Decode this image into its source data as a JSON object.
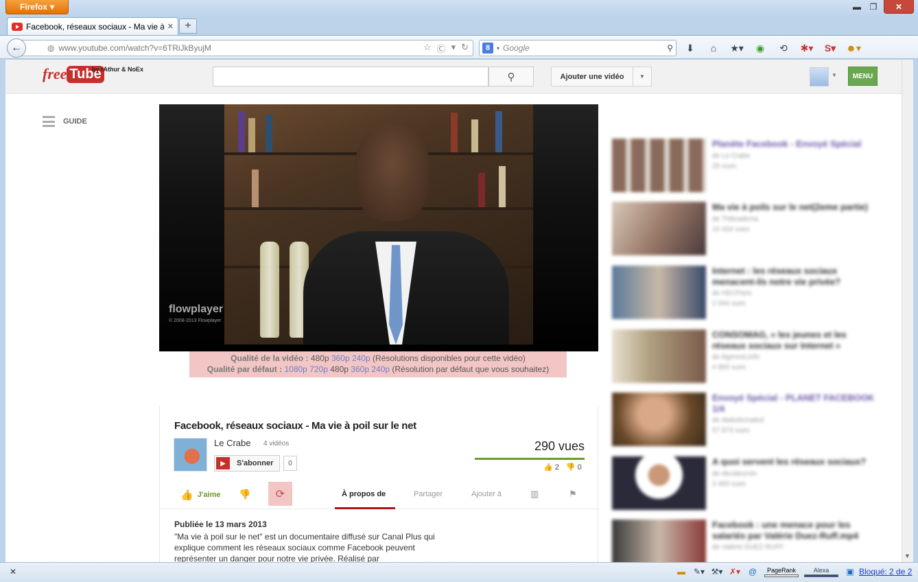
{
  "browser": {
    "app_button": "Firefox",
    "tab_title": "Facebook, réseaux sociaux - Ma vie à poil...",
    "url": "www.youtube.com/watch?v=6TRiJkByujM",
    "search_placeholder": "Google",
    "status_blocked": "Bloqué: 2 de 2",
    "pagerank_label": "PageRank",
    "alexa_label": "Alexa"
  },
  "header": {
    "logo_free": "free",
    "logo_tube": "Tube",
    "logo_by": "by rAthur & NoEx",
    "upload_label": "Ajouter une vidéo",
    "menu_label": "MENU",
    "guide_label": "GUIDE"
  },
  "player": {
    "brand": "flowplayer",
    "copyright": "© 2008-2013 Flowplayer"
  },
  "quality": {
    "line1_label": "Qualité de la vidéo :",
    "line1_options": [
      "480p",
      "360p",
      "240p"
    ],
    "line1_note": "(Résolutions disponibles pour cette vidéo)",
    "line2_label": "Qualité par défaut :",
    "line2_options": [
      "1080p",
      "720p",
      "480p",
      "360p",
      "240p"
    ],
    "line2_note": "(Résolution par défaut que vous souhaitez)"
  },
  "video": {
    "title": "Facebook, réseaux sociaux - Ma vie à poil sur le net",
    "channel": "Le Crabe",
    "video_count": "4 vidéos",
    "subscribe_label": "S'abonner",
    "subscriber_count": "0",
    "views": "290 vues",
    "likes": "2",
    "dislikes": "0",
    "like_label": "J'aime",
    "tabs": {
      "about": "À propos de",
      "share": "Partager",
      "add": "Ajouter à"
    },
    "published": "Publiée le 13 mars 2013",
    "description": "\"Ma vie à poil sur le net\" est un documentaire diffusé sur Canal Plus qui explique comment les réseaux sociaux comme Facebook peuvent représenter un danger pour notre vie privée. Réalisé par"
  },
  "related": [
    {
      "title": "Planète Facebook - Envoyé Spécial",
      "channel": "de Le Crabe",
      "views": "26 vues",
      "color": "#6b55a8"
    },
    {
      "title": "Ma vie à poils sur le net(2eme partie)",
      "channel": "de Thibradema",
      "views": "10 434 vues",
      "color": "#333333"
    },
    {
      "title": "Internet : les réseaux sociaux menacent-ils notre vie privée?",
      "channel": "de HECParis",
      "views": "2 044 vues",
      "color": "#333333"
    },
    {
      "title": "CONSOMAG, « les jeunes et les réseaux sociaux sur Internet »",
      "channel": "de AgenceLinfo",
      "views": "4 865 vues",
      "color": "#333333"
    },
    {
      "title": "Envoyé Spécial - PLANET FACEBOOK 1/4",
      "channel": "de diabolicmaled",
      "views": "57 873 vues",
      "color": "#6b55a8"
    },
    {
      "title": "A quoi servent les réseaux sociaux?",
      "channel": "de decideurstv",
      "views": "3 400 vues",
      "color": "#333333"
    },
    {
      "title": "Facebook : une menace pour les salariés par Valérie Duez-Ruff.mp4",
      "channel": "de Valérie DUEZ-RUFF",
      "views": "",
      "color": "#333333"
    }
  ],
  "colors": {
    "accent_red": "#c4302b",
    "like_green": "#6a9b2c",
    "quality_bg": "#f3c6c6",
    "quality_link": "#6b7fc7"
  }
}
